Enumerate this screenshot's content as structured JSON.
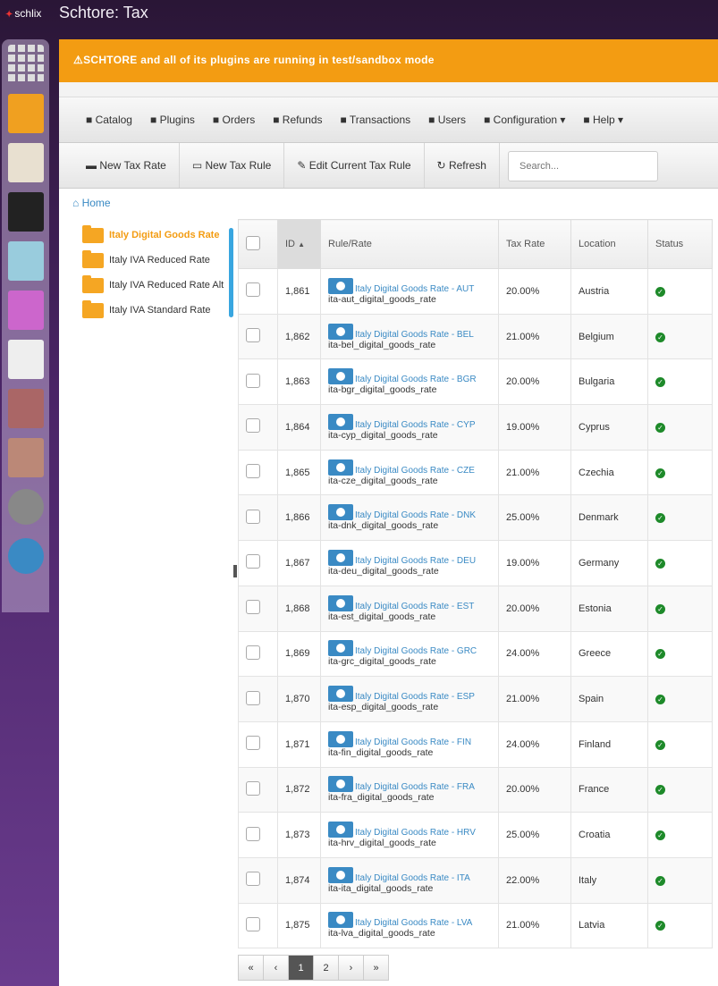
{
  "app": {
    "logo": "schlix",
    "title": "Schtore: Tax"
  },
  "rail": [
    {
      "name": "dashboard",
      "color": "#ddd"
    },
    {
      "name": "store",
      "color": "#f0a020"
    },
    {
      "name": "web-pages",
      "color": "#e8e0d0"
    },
    {
      "name": "blog",
      "color": "#222"
    },
    {
      "name": "block",
      "color": "#9cd"
    },
    {
      "name": "macro",
      "color": "#c6c"
    },
    {
      "name": "menu",
      "color": "#eee"
    },
    {
      "name": "users",
      "color": "#a66"
    },
    {
      "name": "tools",
      "color": "#b87"
    },
    {
      "name": "settings",
      "color": "#888"
    },
    {
      "name": "help",
      "color": "#3a8ac4"
    }
  ],
  "banner": "SCHTORE and all of its plugins are running in test/sandbox mode",
  "menu": [
    {
      "icon": "list-icon",
      "label": "Catalog"
    },
    {
      "icon": "plugins-icon",
      "label": "Plugins"
    },
    {
      "icon": "orders-icon",
      "label": "Orders"
    },
    {
      "icon": "refunds-icon",
      "label": "Refunds"
    },
    {
      "icon": "transactions-icon",
      "label": "Transactions"
    },
    {
      "icon": "users-icon",
      "label": "Users"
    },
    {
      "icon": "gear-icon",
      "label": "Configuration ▾"
    },
    {
      "icon": "help-icon",
      "label": "Help ▾"
    }
  ],
  "toolbar": {
    "new_rate": "New Tax Rate",
    "new_rule": "New Tax Rule",
    "edit_rule": "Edit Current Tax Rule",
    "refresh": "Refresh",
    "search_placeholder": "Search..."
  },
  "breadcrumb": "Home",
  "tree": [
    "Italy Digital Goods Rate",
    "Italy IVA Reduced Rate",
    "Italy IVA Reduced Rate Alt",
    "Italy IVA Standard Rate"
  ],
  "table": {
    "headers": [
      "ID",
      "Rule/Rate",
      "Tax Rate",
      "Location",
      "Status"
    ],
    "rows": [
      [
        "1,861",
        "Italy Digital Goods Rate - AUT",
        "ita-aut_digital_goods_rate",
        "20.00%",
        "Austria"
      ],
      [
        "1,862",
        "Italy Digital Goods Rate - BEL",
        "ita-bel_digital_goods_rate",
        "21.00%",
        "Belgium"
      ],
      [
        "1,863",
        "Italy Digital Goods Rate - BGR",
        "ita-bgr_digital_goods_rate",
        "20.00%",
        "Bulgaria"
      ],
      [
        "1,864",
        "Italy Digital Goods Rate - CYP",
        "ita-cyp_digital_goods_rate",
        "19.00%",
        "Cyprus"
      ],
      [
        "1,865",
        "Italy Digital Goods Rate - CZE",
        "ita-cze_digital_goods_rate",
        "21.00%",
        "Czechia"
      ],
      [
        "1,866",
        "Italy Digital Goods Rate - DNK",
        "ita-dnk_digital_goods_rate",
        "25.00%",
        "Denmark"
      ],
      [
        "1,867",
        "Italy Digital Goods Rate - DEU",
        "ita-deu_digital_goods_rate",
        "19.00%",
        "Germany"
      ],
      [
        "1,868",
        "Italy Digital Goods Rate - EST",
        "ita-est_digital_goods_rate",
        "20.00%",
        "Estonia"
      ],
      [
        "1,869",
        "Italy Digital Goods Rate - GRC",
        "ita-grc_digital_goods_rate",
        "24.00%",
        "Greece"
      ],
      [
        "1,870",
        "Italy Digital Goods Rate - ESP",
        "ita-esp_digital_goods_rate",
        "21.00%",
        "Spain"
      ],
      [
        "1,871",
        "Italy Digital Goods Rate - FIN",
        "ita-fin_digital_goods_rate",
        "24.00%",
        "Finland"
      ],
      [
        "1,872",
        "Italy Digital Goods Rate - FRA",
        "ita-fra_digital_goods_rate",
        "20.00%",
        "France"
      ],
      [
        "1,873",
        "Italy Digital Goods Rate - HRV",
        "ita-hrv_digital_goods_rate",
        "25.00%",
        "Croatia"
      ],
      [
        "1,874",
        "Italy Digital Goods Rate - ITA",
        "ita-ita_digital_goods_rate",
        "22.00%",
        "Italy"
      ],
      [
        "1,875",
        "Italy Digital Goods Rate - LVA",
        "ita-lva_digital_goods_rate",
        "21.00%",
        "Latvia"
      ]
    ]
  },
  "pager": [
    "«",
    "‹",
    "1",
    "2",
    "›",
    "»"
  ]
}
